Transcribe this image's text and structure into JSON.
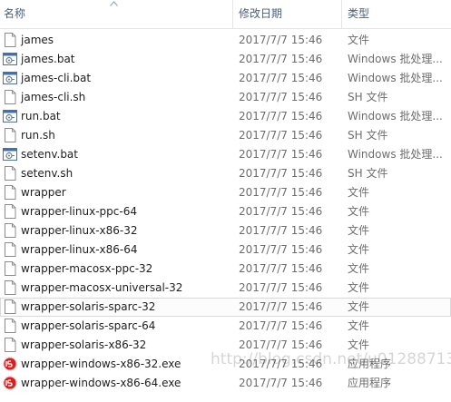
{
  "header": {
    "name_label": "名称",
    "date_label": "修改日期",
    "type_label": "类型"
  },
  "files": [
    {
      "name": "james",
      "date": "2017/7/7 15:46",
      "type": "文件",
      "icon": "blank-file-icon"
    },
    {
      "name": "james.bat",
      "date": "2017/7/7 15:46",
      "type": "Windows 批处理...",
      "icon": "batch-file-icon"
    },
    {
      "name": "james-cli.bat",
      "date": "2017/7/7 15:46",
      "type": "Windows 批处理...",
      "icon": "batch-file-icon"
    },
    {
      "name": "james-cli.sh",
      "date": "2017/7/7 15:46",
      "type": "SH 文件",
      "icon": "blank-file-icon"
    },
    {
      "name": "run.bat",
      "date": "2017/7/7 15:46",
      "type": "Windows 批处理...",
      "icon": "batch-file-icon"
    },
    {
      "name": "run.sh",
      "date": "2017/7/7 15:46",
      "type": "SH 文件",
      "icon": "blank-file-icon"
    },
    {
      "name": "setenv.bat",
      "date": "2017/7/7 15:46",
      "type": "Windows 批处理...",
      "icon": "batch-file-icon"
    },
    {
      "name": "setenv.sh",
      "date": "2017/7/7 15:46",
      "type": "SH 文件",
      "icon": "blank-file-icon"
    },
    {
      "name": "wrapper",
      "date": "2017/7/7 15:46",
      "type": "文件",
      "icon": "blank-file-icon"
    },
    {
      "name": "wrapper-linux-ppc-64",
      "date": "2017/7/7 15:46",
      "type": "文件",
      "icon": "blank-file-icon"
    },
    {
      "name": "wrapper-linux-x86-32",
      "date": "2017/7/7 15:46",
      "type": "文件",
      "icon": "blank-file-icon"
    },
    {
      "name": "wrapper-linux-x86-64",
      "date": "2017/7/7 15:46",
      "type": "文件",
      "icon": "blank-file-icon"
    },
    {
      "name": "wrapper-macosx-ppc-32",
      "date": "2017/7/7 15:46",
      "type": "文件",
      "icon": "blank-file-icon"
    },
    {
      "name": "wrapper-macosx-universal-32",
      "date": "2017/7/7 15:46",
      "type": "文件",
      "icon": "blank-file-icon"
    },
    {
      "name": "wrapper-solaris-sparc-32",
      "date": "2017/7/7 15:46",
      "type": "文件",
      "icon": "blank-file-icon",
      "selected": true
    },
    {
      "name": "wrapper-solaris-sparc-64",
      "date": "2017/7/7 15:46",
      "type": "文件",
      "icon": "blank-file-icon"
    },
    {
      "name": "wrapper-solaris-x86-32",
      "date": "2017/7/7 15:46",
      "type": "文件",
      "icon": "blank-file-icon"
    },
    {
      "name": "wrapper-windows-x86-32.exe",
      "date": "2017/7/7 15:46",
      "type": "应用程序",
      "icon": "exe-app-icon"
    },
    {
      "name": "wrapper-windows-x86-64.exe",
      "date": "2017/7/7 15:46",
      "type": "应用程序",
      "icon": "exe-app-icon"
    }
  ],
  "watermark": "http://blog.csdn.net/u012887137",
  "colors": {
    "header_text": "#4c607a",
    "secondary_text": "#6d6d6d",
    "exe_icon": "#d42222"
  }
}
